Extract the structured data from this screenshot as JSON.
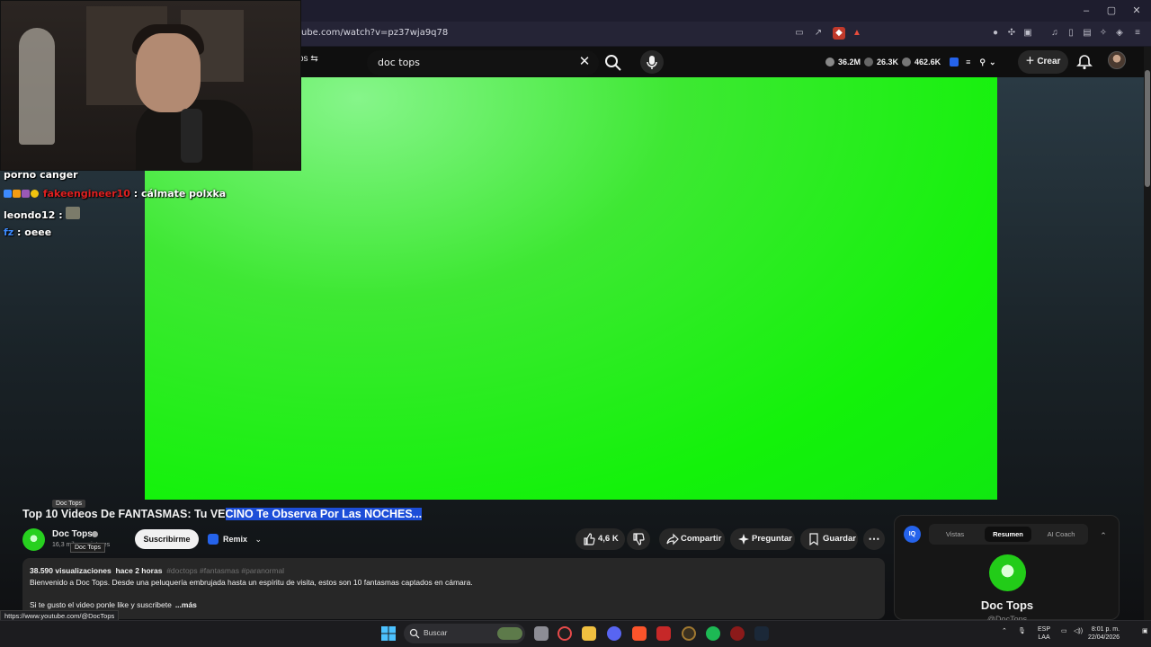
{
  "browser": {
    "url": "ube.com/watch?v=pz37wja9q78",
    "window_controls": [
      "–",
      "▢",
      "✕"
    ]
  },
  "youtube_bar": {
    "filter_chip": "os ⇆",
    "search_value": "doc tops",
    "stats": [
      "36.2M",
      "26.3K",
      "462.6K"
    ],
    "create_label": "Crear"
  },
  "chat": {
    "messages": [
      {
        "user": "porno canger",
        "text": ""
      },
      {
        "user": "fakeengineer10",
        "text": ": cálmate polxka",
        "user_color": "#e02020"
      },
      {
        "user": "leondo12",
        "text": ":"
      },
      {
        "user": "fz",
        "text": ": oeee",
        "user_color": "#3d8bff"
      }
    ]
  },
  "video": {
    "title_plain": "Top 10 Videos De FANTASMAS: Tu VE",
    "title_selected": "CINO Te Observa Por Las NOCHES...",
    "title_tooltip": "Doc Tops",
    "channel_name": "Doc Tops",
    "subs_count": "16,3 mil suscriptores",
    "channel_tooltip": "Doc Tops",
    "subscribe_label": "Suscribirme",
    "remix_label": "Remix",
    "like_count": "4,6 K",
    "share_label": "Compartir",
    "ask_label": "Preguntar",
    "save_label": "Guardar",
    "more_label": "⋯"
  },
  "description": {
    "views": "38.590 visualizaciones",
    "age": "hace 2 horas",
    "tags": "#doctops #fantasmas #paranormal",
    "line1": "Bienvenido a Doc Tops.  Desde una peluquería embrujada hasta un espíritu de visita, estos son 10 fantasmas captados en cámara.",
    "line2": "Si te gusto el video ponle like y suscribete",
    "more": "...más"
  },
  "side_panel": {
    "iq_label": "IQ",
    "tabs": [
      "Vistas",
      "Resumen",
      "AI Coach"
    ],
    "channel": "Doc Tops",
    "handle": "@DocTops"
  },
  "status_url": "https://www.youtube.com/@DocTops",
  "taskbar": {
    "search_label": "Buscar",
    "lang_top": "ESP",
    "lang_bottom": "LAA",
    "time": "8:01 p. m.",
    "date": "22/04/2026"
  },
  "colors": {
    "green_screen": "#13f20a",
    "highlight": "#1d4ed8",
    "accent_blue": "#2563eb"
  }
}
